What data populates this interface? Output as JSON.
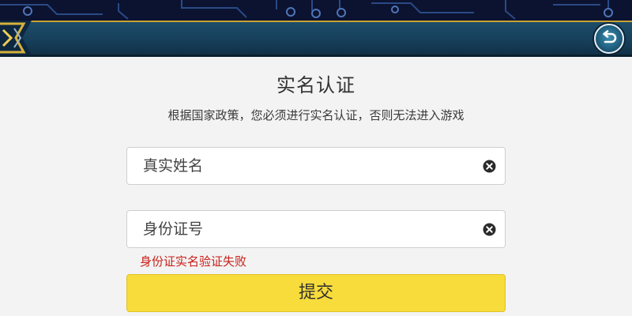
{
  "header": {
    "back_icon": "back-arrow-icon",
    "accent_color": "#c9a233",
    "bar_color": "#1d4d6a"
  },
  "dialog": {
    "title": "实名认证",
    "subtitle": "根据国家政策，您必须进行实名认证，否则无法进入游戏",
    "name_field": {
      "placeholder": "真实姓名",
      "value": "",
      "clear_icon": "clear-icon"
    },
    "id_field": {
      "placeholder": "身份证号",
      "value": "",
      "clear_icon": "clear-icon"
    },
    "error_message": "身份证实名验证失败",
    "error_color": "#c8201a",
    "submit_label": "提交",
    "submit_color": "#f7dc3c"
  }
}
